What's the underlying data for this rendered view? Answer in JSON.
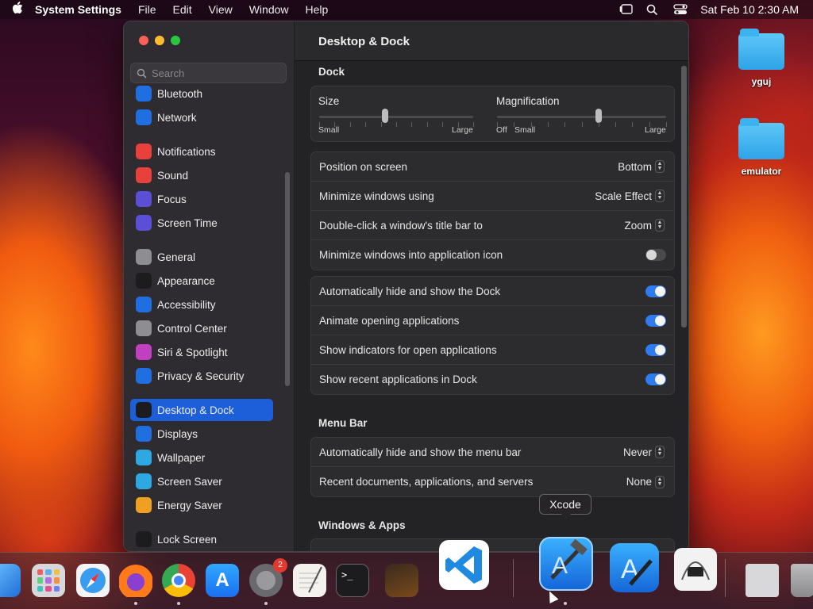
{
  "menubar": {
    "app_name": "System Settings",
    "items": [
      "File",
      "Edit",
      "View",
      "Window",
      "Help"
    ],
    "datetime": "Sat Feb 10  2:30 AM"
  },
  "desktop": {
    "icons": [
      "yguj",
      "emulator"
    ]
  },
  "window": {
    "title": "Desktop & Dock",
    "search_placeholder": "Search",
    "sidebar": [
      {
        "label": "Bluetooth",
        "icon": "bluetooth-icon",
        "color": "#1f6fe0"
      },
      {
        "label": "Network",
        "icon": "globe-icon",
        "color": "#1f6fe0"
      },
      {
        "label": "Notifications",
        "icon": "bell-icon",
        "color": "#e8413b"
      },
      {
        "label": "Sound",
        "icon": "speaker-icon",
        "color": "#e8413b"
      },
      {
        "label": "Focus",
        "icon": "moon-icon",
        "color": "#5b4fd8"
      },
      {
        "label": "Screen Time",
        "icon": "hourglass-icon",
        "color": "#5b4fd8"
      },
      {
        "label": "General",
        "icon": "gear-icon",
        "color": "#8d8d92"
      },
      {
        "label": "Appearance",
        "icon": "contrast-icon",
        "color": "#1c1c1e"
      },
      {
        "label": "Accessibility",
        "icon": "accessibility-icon",
        "color": "#1f6fe0"
      },
      {
        "label": "Control Center",
        "icon": "toggles-icon",
        "color": "#8d8d92"
      },
      {
        "label": "Siri & Spotlight",
        "icon": "siri-icon",
        "color": "#c040c0"
      },
      {
        "label": "Privacy & Security",
        "icon": "hand-icon",
        "color": "#1f6fe0"
      },
      {
        "label": "Desktop & Dock",
        "icon": "dock-icon",
        "color": "#1c1c1e"
      },
      {
        "label": "Displays",
        "icon": "sun-icon",
        "color": "#1f6fe0"
      },
      {
        "label": "Wallpaper",
        "icon": "flower-icon",
        "color": "#2ea8e0"
      },
      {
        "label": "Screen Saver",
        "icon": "screensaver-icon",
        "color": "#2ea8e0"
      },
      {
        "label": "Energy Saver",
        "icon": "bulb-icon",
        "color": "#f0a020"
      },
      {
        "label": "Lock Screen",
        "icon": "lock-icon",
        "color": "#1c1c1e"
      }
    ],
    "dock_section": {
      "title": "Dock",
      "size_label": "Size",
      "size_min": "Small",
      "size_max": "Large",
      "size_value": 0.43,
      "mag_label": "Magnification",
      "mag_off": "Off",
      "mag_min": "Small",
      "mag_max": "Large",
      "mag_value": 0.6,
      "rows": [
        {
          "label": "Position on screen",
          "value": "Bottom"
        },
        {
          "label": "Minimize windows using",
          "value": "Scale Effect"
        },
        {
          "label": "Double-click a window's title bar to",
          "value": "Zoom"
        },
        {
          "label": "Minimize windows into application icon",
          "toggle": false
        }
      ],
      "toggles": [
        {
          "label": "Automatically hide and show the Dock",
          "on": true
        },
        {
          "label": "Animate opening applications",
          "on": true
        },
        {
          "label": "Show indicators for open applications",
          "on": true
        },
        {
          "label": "Show recent applications in Dock",
          "on": true
        }
      ]
    },
    "menubar_section": {
      "title": "Menu Bar",
      "rows": [
        {
          "label": "Automatically hide and show the menu bar",
          "value": "Never"
        },
        {
          "label": "Recent documents, applications, and servers",
          "value": "None"
        }
      ]
    },
    "windows_section": {
      "title": "Windows & Apps"
    }
  },
  "dock": {
    "tooltip": "Xcode",
    "badge": "2"
  }
}
